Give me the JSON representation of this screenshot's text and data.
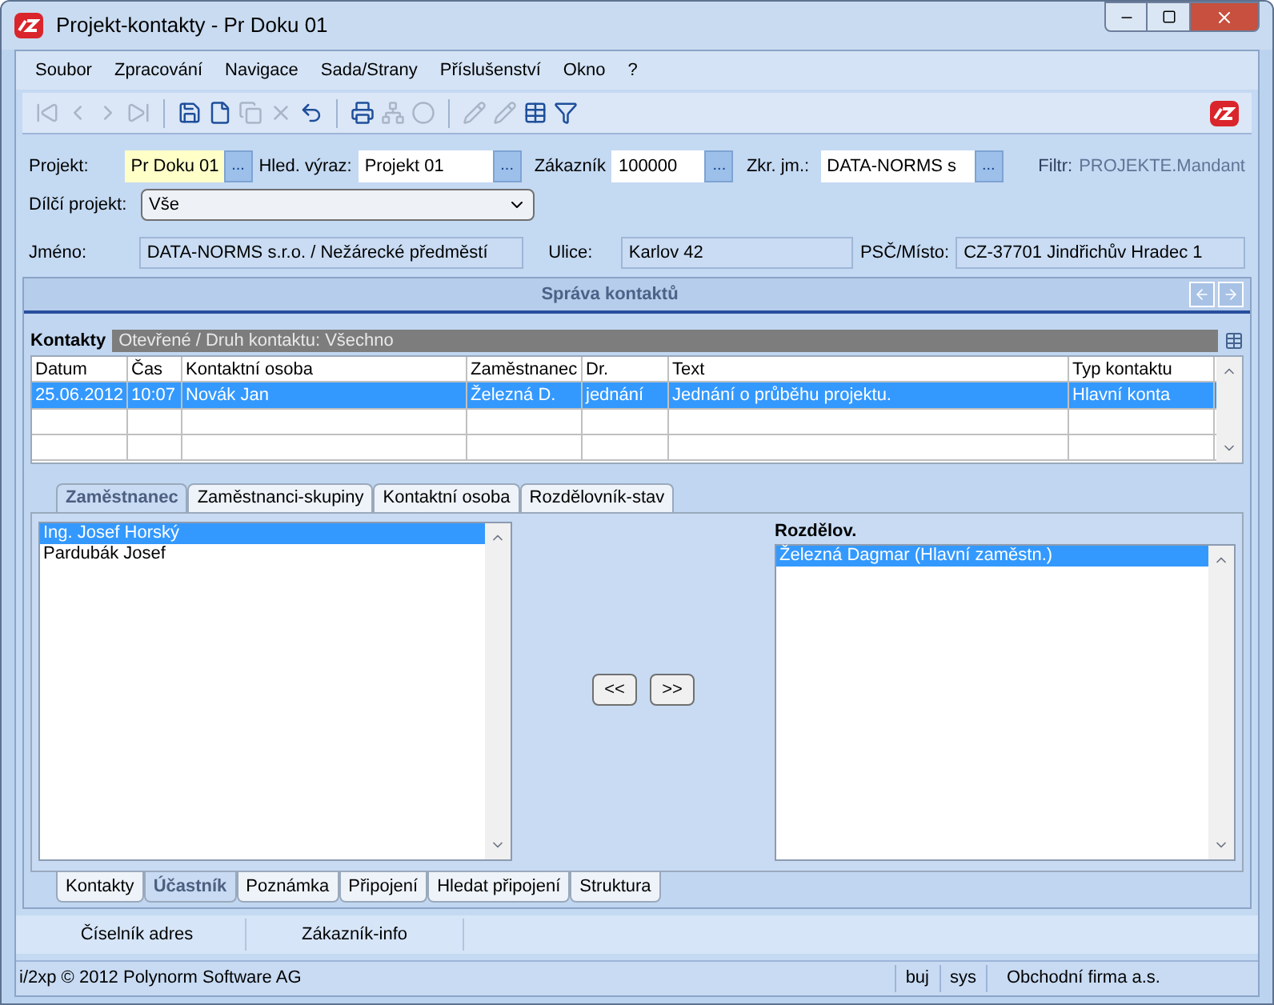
{
  "window": {
    "title": "Projekt-kontakty - Pr Doku 01"
  },
  "menu": [
    "Soubor",
    "Zpracování",
    "Navigace",
    "Sada/Strany",
    "Příslušenství",
    "Okno",
    "?"
  ],
  "toolbar": [
    {
      "kind": "first",
      "disabled": true
    },
    {
      "kind": "prev",
      "disabled": true
    },
    {
      "kind": "next",
      "disabled": true
    },
    {
      "kind": "last",
      "disabled": true
    },
    {
      "kind": "sep"
    },
    {
      "kind": "save",
      "disabled": false
    },
    {
      "kind": "new",
      "disabled": false
    },
    {
      "kind": "copy",
      "disabled": true
    },
    {
      "kind": "delete",
      "disabled": true
    },
    {
      "kind": "undo",
      "disabled": false
    },
    {
      "kind": "sep"
    },
    {
      "kind": "print",
      "disabled": false
    },
    {
      "kind": "tree",
      "disabled": true
    },
    {
      "kind": "circle",
      "disabled": true
    },
    {
      "kind": "sep"
    },
    {
      "kind": "edit",
      "disabled": true
    },
    {
      "kind": "edit",
      "disabled": true
    },
    {
      "kind": "table",
      "disabled": false
    },
    {
      "kind": "filter",
      "disabled": false
    }
  ],
  "form": {
    "projekt": {
      "label": "Projekt:",
      "value": "Pr Doku 01",
      "browse": "..."
    },
    "hled": {
      "label": "Hled. výraz:",
      "value": "Projekt 01",
      "browse": "..."
    },
    "zakaznik": {
      "label": "Zákazník",
      "value": "100000",
      "browse": "..."
    },
    "zkr": {
      "label": "Zkr. jm.:",
      "value": "DATA-NORMS s",
      "browse": "..."
    },
    "filtr": {
      "label": "Filtr:",
      "value": "PROJEKTE.Mandant"
    },
    "dilci": {
      "label": "Dílčí projekt:",
      "value": "Vše"
    },
    "jmeno": {
      "label": "Jméno:",
      "value": "DATA-NORMS s.r.o. / Nežárecké předměstí"
    },
    "ulice": {
      "label": "Ulice:",
      "value": "Karlov 42"
    },
    "psc": {
      "label": "PSČ/Místo:",
      "value": "CZ-37701 Jindřichův Hradec 1"
    }
  },
  "section_title": "Správa kontaktů",
  "contacts": {
    "label": "Kontakty",
    "filter": "Otevřené / Druh kontaktu: Všechno",
    "columns": [
      "Datum",
      "Čas",
      "Kontaktní osoba",
      "Zaměstnanec",
      "Dr.",
      "Text",
      "Typ kontaktu"
    ],
    "rows": [
      {
        "selected": true,
        "cells": [
          "25.06.2012",
          "10:07",
          "Novák Jan",
          "Železná D.",
          "jednání",
          "Jednání o průběhu projektu.",
          "Hlavní konta"
        ]
      }
    ]
  },
  "inner_tabs": [
    {
      "label": "Zaměstnanec",
      "selected": true
    },
    {
      "label": "Zaměstnanci-skupiny",
      "selected": false
    },
    {
      "label": "Kontaktní osoba",
      "selected": false
    },
    {
      "label": "Rozdělovník-stav",
      "selected": false
    }
  ],
  "left_list": [
    {
      "label": "Ing. Josef Horský",
      "selected": true
    },
    {
      "label": "Pardubák Josef",
      "selected": false
    }
  ],
  "move_buttons": [
    "<<",
    ">>"
  ],
  "right_title": "Rozdělov.",
  "right_list": [
    {
      "label": "Železná Dagmar (Hlavní zaměstn.)",
      "selected": true
    }
  ],
  "bottom_tabs": [
    {
      "label": "Kontakty",
      "selected": false
    },
    {
      "label": "Účastník",
      "selected": true
    },
    {
      "label": "Poznámka",
      "selected": false
    },
    {
      "label": "Připojení",
      "selected": false
    },
    {
      "label": "Hledat připojení",
      "selected": false
    },
    {
      "label": "Struktura",
      "selected": false
    }
  ],
  "bottom_buttons": [
    "Číselník adres",
    "Zákazník-info"
  ],
  "status_bar": {
    "copyright": "i/2xp © 2012 Polynorm Software AG",
    "user": "buj",
    "db": "sys",
    "company": "Obchodní firma a.s."
  }
}
